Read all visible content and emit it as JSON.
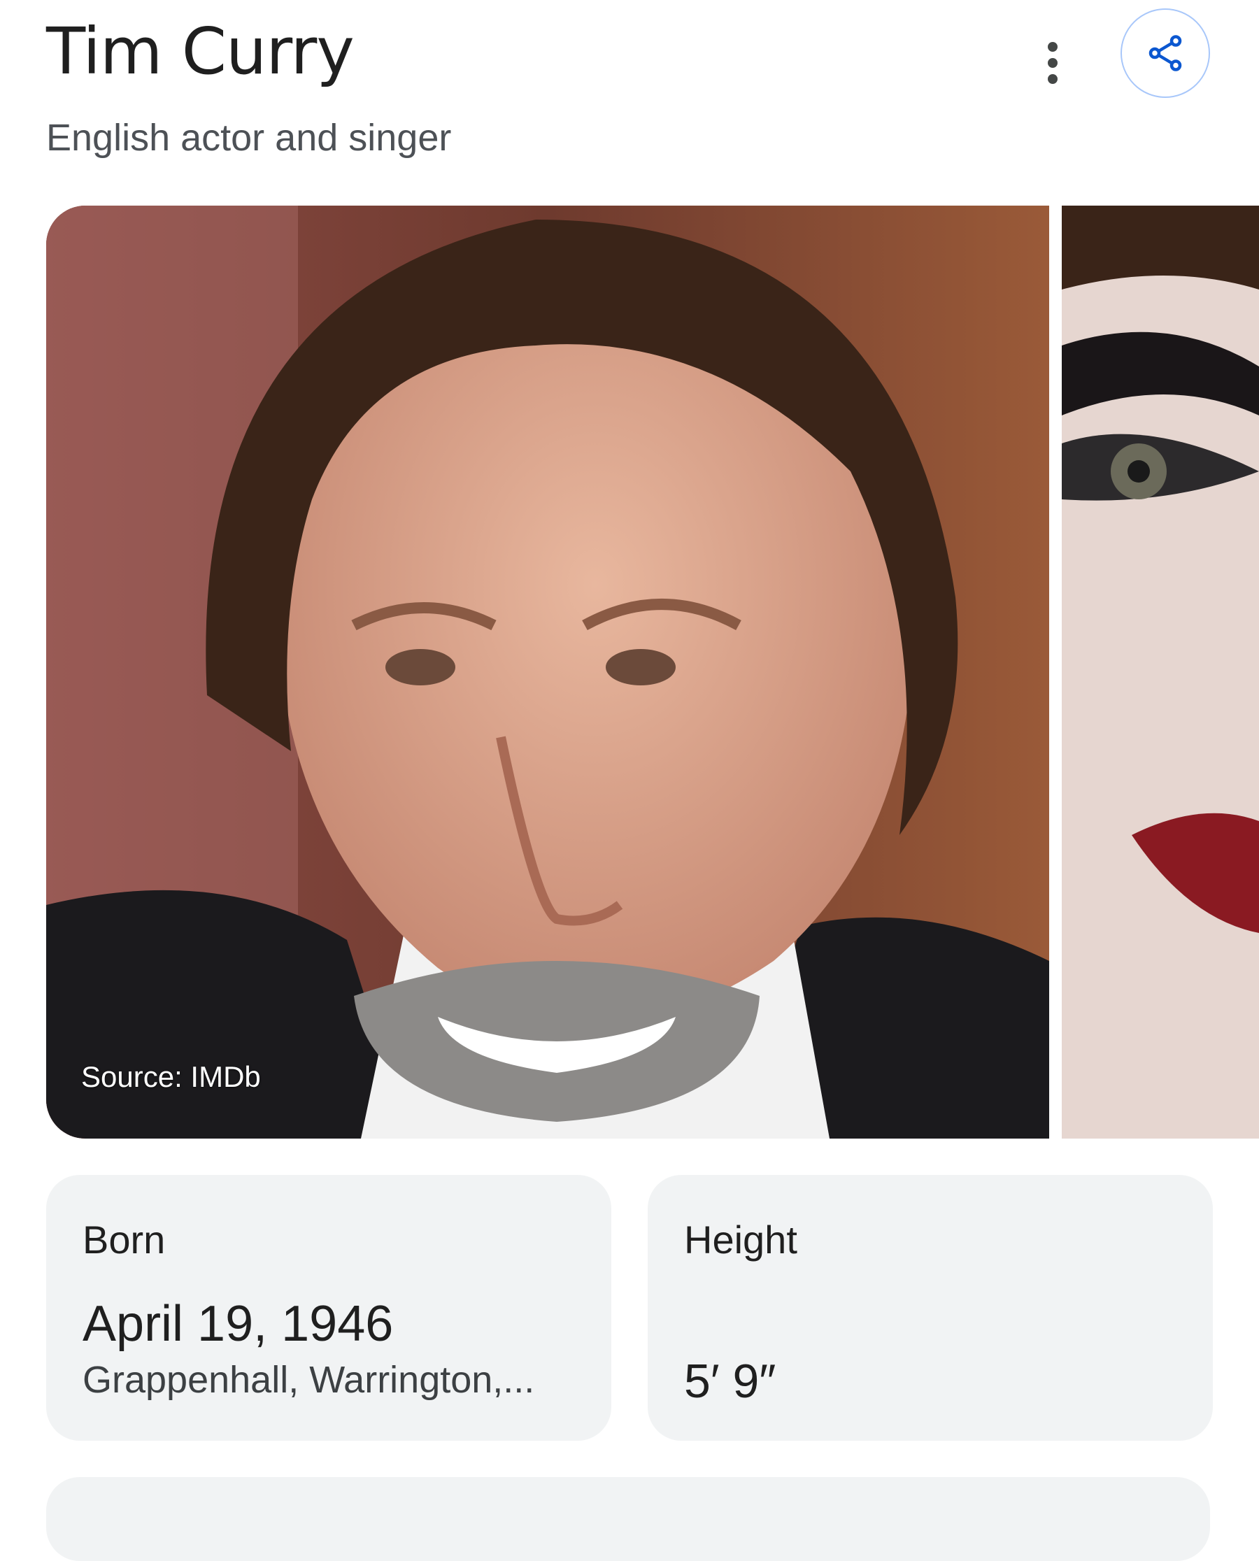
{
  "header": {
    "title": "Tim Curry",
    "subtitle": "English actor and singer"
  },
  "icons": {
    "more": "more-vert-icon",
    "share": "share-icon"
  },
  "gallery": {
    "main_photo_source": "Source: IMDb"
  },
  "facts": {
    "born": {
      "label": "Born",
      "value": "April 19, 1946",
      "place": "Grappenhall, Warrington,..."
    },
    "height": {
      "label": "Height",
      "value": "5′ 9″"
    }
  },
  "colors": {
    "card_bg": "#f1f3f4",
    "share_border": "#a8c7fa",
    "share_icon": "#0b57d0"
  }
}
